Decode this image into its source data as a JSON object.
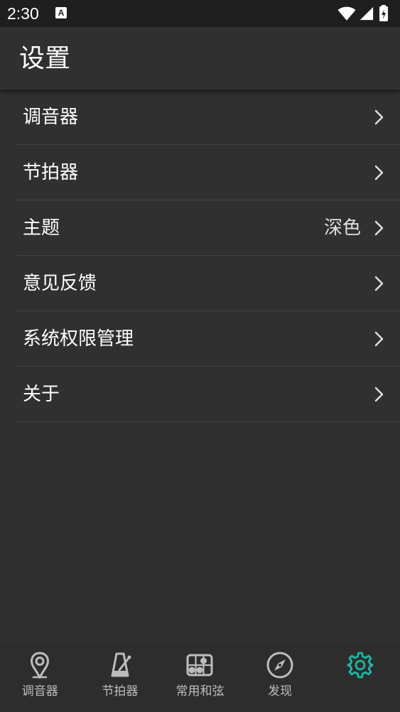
{
  "status_bar": {
    "time": "2:30",
    "notification_icon_letter": "A"
  },
  "app_bar": {
    "title": "设置"
  },
  "settings": {
    "items": [
      {
        "label": "调音器",
        "value": ""
      },
      {
        "label": "节拍器",
        "value": ""
      },
      {
        "label": "主题",
        "value": "深色"
      },
      {
        "label": "意见反馈",
        "value": ""
      },
      {
        "label": "系统权限管理",
        "value": ""
      },
      {
        "label": "关于",
        "value": ""
      }
    ]
  },
  "bottom_nav": {
    "items": [
      {
        "label": "调音器",
        "icon": "tuner-pin-icon",
        "active": false
      },
      {
        "label": "节拍器",
        "icon": "metronome-icon",
        "active": false
      },
      {
        "label": "常用和弦",
        "icon": "chord-grid-icon",
        "active": false
      },
      {
        "label": "发现",
        "icon": "compass-icon",
        "active": false
      },
      {
        "label": "",
        "icon": "gear-icon",
        "active": true
      }
    ]
  },
  "colors": {
    "background": "#303030",
    "status_bar": "#1f1f1f",
    "divider": "#444444",
    "nav_inactive": "#bdbdbd",
    "accent": "#1fb5a6"
  }
}
